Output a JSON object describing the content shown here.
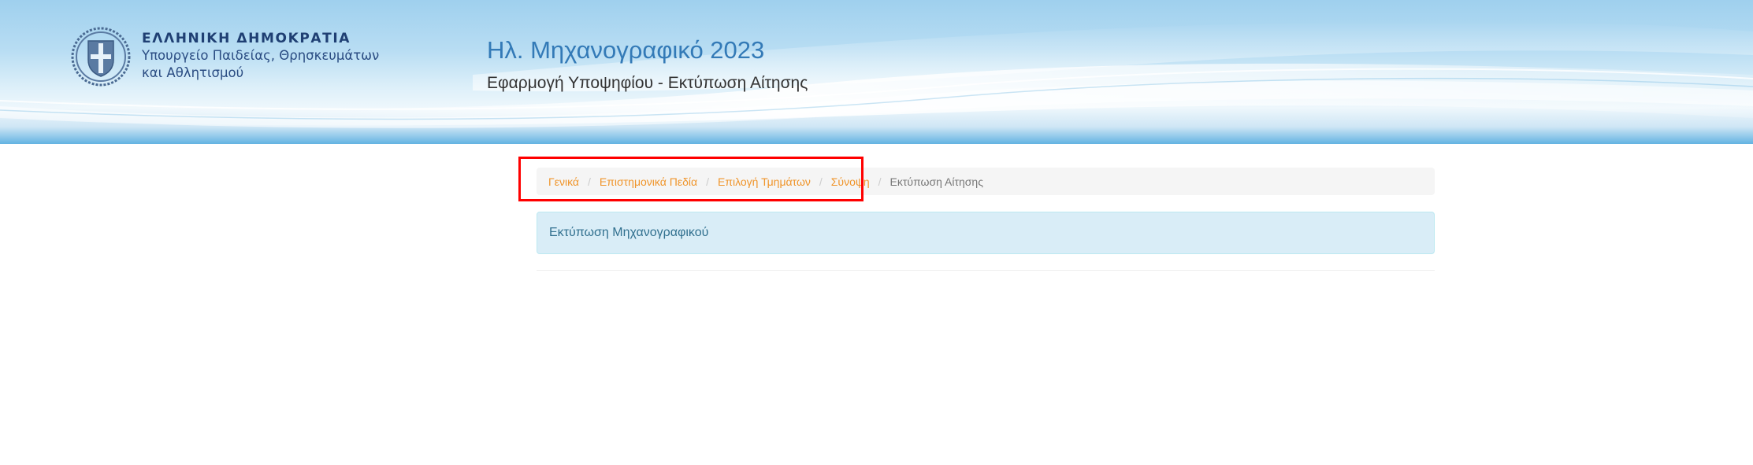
{
  "header": {
    "logo": {
      "line1": "ΕΛΛΗΝΙΚΗ ΔΗΜΟΚΡΑΤΙΑ",
      "line2": "Υπουργείο Παιδείας, Θρησκευμάτων",
      "line3": "και Αθλητισμού"
    },
    "title": "Ηλ. Μηχανογραφικό 2023",
    "subtitle": "Εφαρμογή Υποψηφίου - Εκτύπωση Αίτησης"
  },
  "breadcrumb": {
    "items": [
      {
        "label": "Γενικά",
        "active": false
      },
      {
        "label": "Επιστημονικά Πεδία",
        "active": false
      },
      {
        "label": "Επιλογή Τμημάτων",
        "active": false
      },
      {
        "label": "Σύνοψη",
        "active": false
      },
      {
        "label": "Εκτύπωση Αίτησης",
        "active": true
      }
    ],
    "separator": "/"
  },
  "main": {
    "info_panel_text": "Εκτύπωση Μηχανογραφικού"
  },
  "colors": {
    "title": "#337ab7",
    "breadcrumb_link": "#f0952b",
    "breadcrumb_active": "#777777",
    "info_bg": "#d9edf7",
    "info_text": "#31708f",
    "highlight": "#ff0000"
  }
}
